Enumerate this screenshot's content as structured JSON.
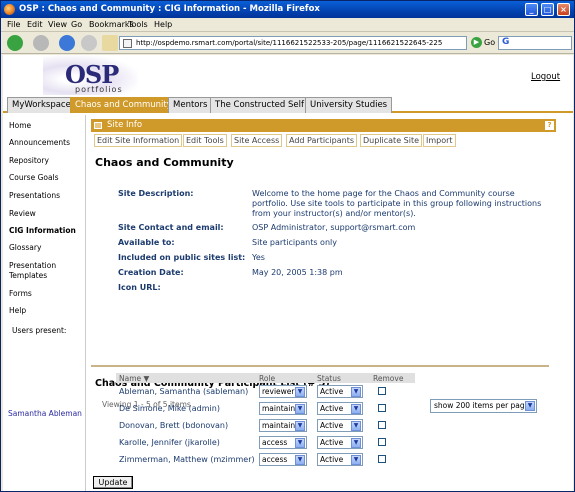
{
  "window": {
    "title": "OSP : Chaos and Community : CIG Information - Mozilla Firefox",
    "controls": {
      "minimize": "_",
      "maximize": "□",
      "close": "×"
    }
  },
  "menubar": [
    {
      "label": "File"
    },
    {
      "label": "Edit"
    },
    {
      "label": "View"
    },
    {
      "label": "Go"
    },
    {
      "label": "Bookmarks"
    },
    {
      "label": "Tools"
    },
    {
      "label": "Help"
    }
  ],
  "navbar": {
    "url": "http://ospdemo.rsmart.com/portal/site/1116621522533-205/page/1116621522645-225",
    "go_label": "Go",
    "search_engine_glyph": "G"
  },
  "header": {
    "logo_text": "OSP",
    "logo_subtext": "portfolios",
    "logout_label": "Logout"
  },
  "site_tabs": [
    {
      "label": "MyWorkspace",
      "selected": false
    },
    {
      "label": "Chaos and Community",
      "selected": true
    },
    {
      "label": "Mentors",
      "selected": false
    },
    {
      "label": "The Constructed Self",
      "selected": false
    },
    {
      "label": "University Studies",
      "selected": false
    }
  ],
  "leftnav": {
    "items": [
      {
        "label": "Home"
      },
      {
        "label": "Announcements"
      },
      {
        "label": "Repository"
      },
      {
        "label": "Course Goals"
      },
      {
        "label": "Presentations"
      },
      {
        "label": "Review"
      },
      {
        "label": "CIG Information",
        "selected": true
      },
      {
        "label": "Glossary"
      },
      {
        "label": "Presentation Templates"
      },
      {
        "label": "Forms"
      },
      {
        "label": "Help"
      },
      {
        "label": "Users present:"
      }
    ],
    "present_user": "Samantha Ableman"
  },
  "panel": {
    "title": "Site Info",
    "help_glyph": "?",
    "toolbar": [
      {
        "label": "Edit Site Information"
      },
      {
        "label": "Edit Tools"
      },
      {
        "label": "Site Access"
      },
      {
        "label": "Add Participants"
      },
      {
        "label": "Duplicate Site"
      },
      {
        "label": "Import"
      }
    ],
    "site_title": "Chaos and Community",
    "fields": {
      "description_label": "Site Description:",
      "description_value": "Welcome to the home page for the Chaos and Community course portfolio. Use site tools to participate in this group following instructions from your instructor(s) and/or mentor(s).",
      "contact_label": "Site Contact and email:",
      "contact_name": "OSP Administrator,",
      "contact_email": "support@rsmart.com",
      "available_label": "Available to:",
      "available_value": "Site participants only",
      "public_label": "Included on public sites list:",
      "public_value": "Yes",
      "created_label": "Creation Date:",
      "created_value": "May 20, 2005 1:38 pm",
      "icon_label": "Icon URL:"
    },
    "participants": {
      "title": "Chaos and Community Participant List (# 5)",
      "viewing": "Viewing 1 - 5 of 5 items",
      "page_size": "show 200 items per page",
      "columns": {
        "name": "Name",
        "role": "Role",
        "status": "Status",
        "remove": "Remove"
      },
      "rows": [
        {
          "name": "Ableman, Samantha (sableman)",
          "role": "reviewer",
          "status": "Active"
        },
        {
          "name": "De Simone, Mike (admin)",
          "role": "maintain",
          "status": "Active"
        },
        {
          "name": "Donovan, Brett (bdonovan)",
          "role": "maintain",
          "status": "Active"
        },
        {
          "name": "Karolle, Jennifer (jkarolle)",
          "role": "access",
          "status": "Active"
        },
        {
          "name": "Zimmerman, Matthew (mzimmer)",
          "role": "access",
          "status": "Active"
        }
      ],
      "update_label": "Update"
    }
  },
  "colors": {
    "accent": "#d09a2a",
    "text_blue": "#1c3b6e",
    "titlebar": "#0342b0"
  }
}
